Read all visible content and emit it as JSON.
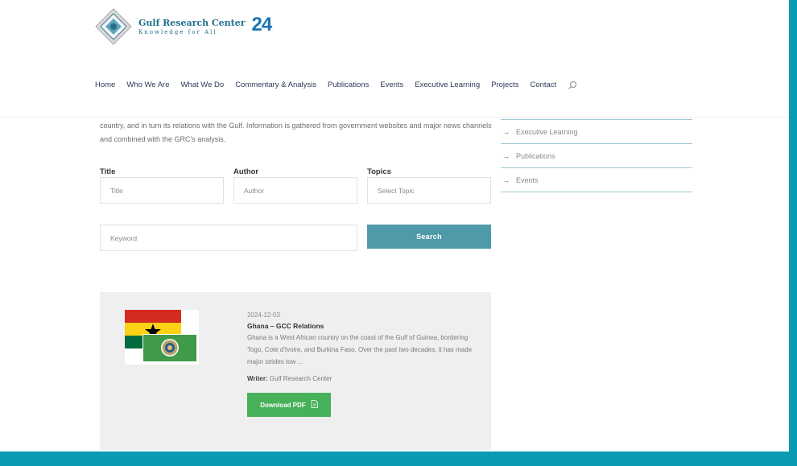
{
  "logo": {
    "title": "Gulf Research Center",
    "tagline": "Knowledge for All",
    "anniversary": "24"
  },
  "nav": {
    "items": [
      {
        "label": "Home"
      },
      {
        "label": "Who We Are"
      },
      {
        "label": "What We Do"
      },
      {
        "label": "Commentary & Analysis"
      },
      {
        "label": "Publications"
      },
      {
        "label": "Events"
      },
      {
        "label": "Executive Learning"
      },
      {
        "label": "Projects"
      },
      {
        "label": "Contact"
      }
    ]
  },
  "intro_text": "country, and in turn its relations with the Gulf. Information is gathered from government websites and major news channels and combined with the GRC's analysis.",
  "filters": {
    "title_label": "Title",
    "title_placeholder": "Title",
    "author_label": "Author",
    "author_placeholder": "Author",
    "topics_label": "Topics",
    "topics_selected": "Select Topic",
    "keyword_placeholder": "Keyword",
    "search_label": "Search"
  },
  "sidebar": {
    "items": [
      {
        "label": "Executive Learning"
      },
      {
        "label": "Publications"
      },
      {
        "label": "Events"
      }
    ]
  },
  "result": {
    "date": "2024-12-03",
    "title": "Ghana – GCC Relations",
    "description": "Ghana is a West African country on the coast of the Gulf of Guinea, bordering Togo, Cote d'Ivoire, and Burkina Faso. Over the past two decades, it has made major strides tow ...",
    "writer_label": "Writer:",
    "writer": "Gulf Research Center",
    "download_label": "Download PDF"
  },
  "colors": {
    "frame": "#0b9bb3",
    "search_button": "#4f9aa8",
    "download_button": "#46b05a",
    "audio_button": "#5b8cc9"
  },
  "icons": [
    "speaker-icon",
    "search-icon",
    "arrow-right-icon",
    "pdf-icon"
  ]
}
